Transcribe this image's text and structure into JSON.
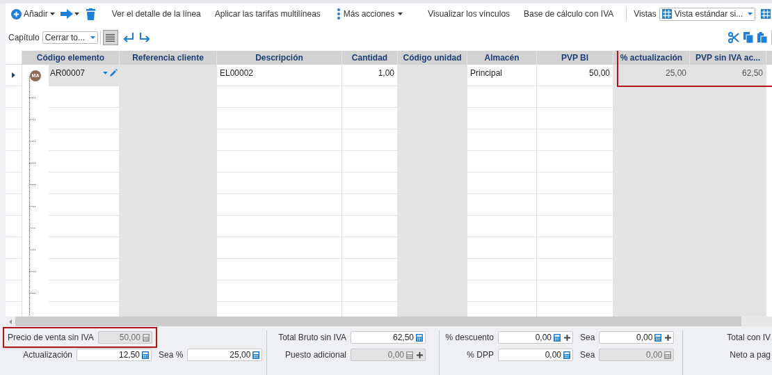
{
  "toolbar": {
    "add_button": "Añadir",
    "actions": [
      "Ver el detalle de la línea",
      "Aplicar las tarifas multilíneas"
    ],
    "more_button": "Más acciones",
    "links": [
      "Visualizar los vínculos",
      "Base de cálculo con IVA"
    ],
    "views_label": "Vistas",
    "views_select": "Vista estándar si..."
  },
  "subtoolbar": {
    "chapter_label": "Capítulo",
    "chapter_select": "Cerrar to...",
    "list_view_selected": true
  },
  "table": {
    "columns": [
      {
        "label": "Código elemento",
        "readonly": false,
        "highlighted": false
      },
      {
        "label": "Referencia cliente",
        "readonly": true,
        "highlighted": false
      },
      {
        "label": "Descripción",
        "readonly": false,
        "highlighted": false
      },
      {
        "label": "Cantidad",
        "readonly": false,
        "highlighted": false
      },
      {
        "label": "Código unidad",
        "readonly": true,
        "highlighted": false
      },
      {
        "label": "Almacén",
        "readonly": false,
        "highlighted": false
      },
      {
        "label": "PVP BI",
        "readonly": false,
        "highlighted": false
      },
      {
        "label": "% actualización",
        "readonly": true,
        "highlighted": true
      },
      {
        "label": "PVP sin IVA ac...",
        "readonly": true,
        "highlighted": true
      }
    ],
    "rows": [
      {
        "selected": true,
        "avatar": "MA",
        "cells": [
          "AR00007",
          "",
          "EL00002",
          "1,00",
          "",
          "Principal",
          "50,00",
          "25,00",
          "62,50"
        ]
      }
    ]
  },
  "footer": {
    "groups": [
      {
        "rows": [
          [
            {
              "label": "Precio de venta sin IVA",
              "value": "50,00",
              "disabled": true,
              "plus": false,
              "highlighted": true
            }
          ],
          [
            {
              "label": "Actualización",
              "value": "12,50",
              "disabled": false,
              "plus": false,
              "highlighted": false
            },
            {
              "label": "Sea %",
              "value": "25,00",
              "disabled": false,
              "plus": false,
              "highlighted": false
            }
          ]
        ]
      },
      {
        "rows": [
          [
            {
              "label": "Total Bruto sin IVA",
              "value": "62,50",
              "disabled": false,
              "plus": false,
              "highlighted": false
            }
          ],
          [
            {
              "label": "Puesto adicional",
              "value": "0,00",
              "disabled": true,
              "plus": true,
              "highlighted": false
            }
          ]
        ]
      },
      {
        "rows": [
          [
            {
              "label": "% descuento",
              "value": "0,00",
              "disabled": false,
              "plus": true,
              "highlighted": false
            },
            {
              "label": "Sea",
              "value": "0,00",
              "disabled": false,
              "plus": true,
              "highlighted": false
            }
          ],
          [
            {
              "label": "% DPP",
              "value": "0,00",
              "disabled": false,
              "plus": false,
              "highlighted": false
            },
            {
              "label": "Sea",
              "value": "0,00",
              "disabled": true,
              "plus": false,
              "highlighted": false
            }
          ]
        ]
      },
      {
        "rows": [
          [
            {
              "label": "Total con IV"
            }
          ],
          [
            {
              "label": "Neto a pag"
            }
          ]
        ]
      }
    ]
  }
}
